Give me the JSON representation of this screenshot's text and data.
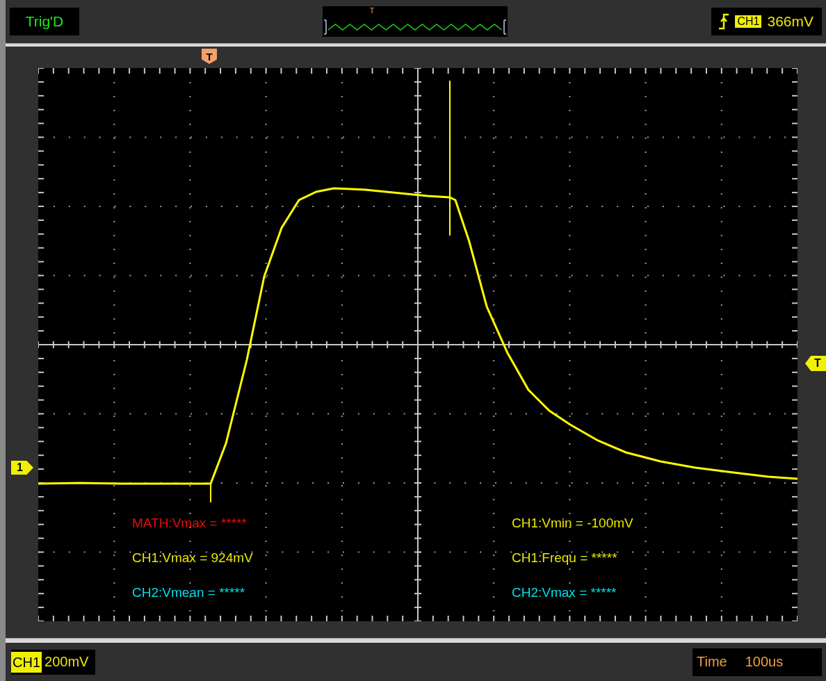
{
  "top_bar": {
    "trigger_status": "Trig'D",
    "preview_trigger_mark": "T",
    "trigger": {
      "channel": "CH1",
      "level": "366mV"
    }
  },
  "markers": {
    "trigger_position": "T",
    "trigger_level": "T",
    "channel_ground": "1"
  },
  "measurements": [
    {
      "text": "MATH:Vmax = *****",
      "color": "#e01010"
    },
    {
      "text": "CH1:Vmin = -100mV",
      "color": "#e8e800"
    },
    {
      "text": "CH1:Vmax = 924mV",
      "color": "#e8e800"
    },
    {
      "text": "CH1:Frequ = *****",
      "color": "#e8e800"
    },
    {
      "text": "CH2:Vmean = *****",
      "color": "#00e0e8"
    },
    {
      "text": "CH2:Vmax = *****",
      "color": "#00e0e8"
    }
  ],
  "bottom_bar": {
    "channel": "CH1",
    "volts_per_div": "200mV",
    "time_label": "Time",
    "time_per_div": "100us"
  }
}
